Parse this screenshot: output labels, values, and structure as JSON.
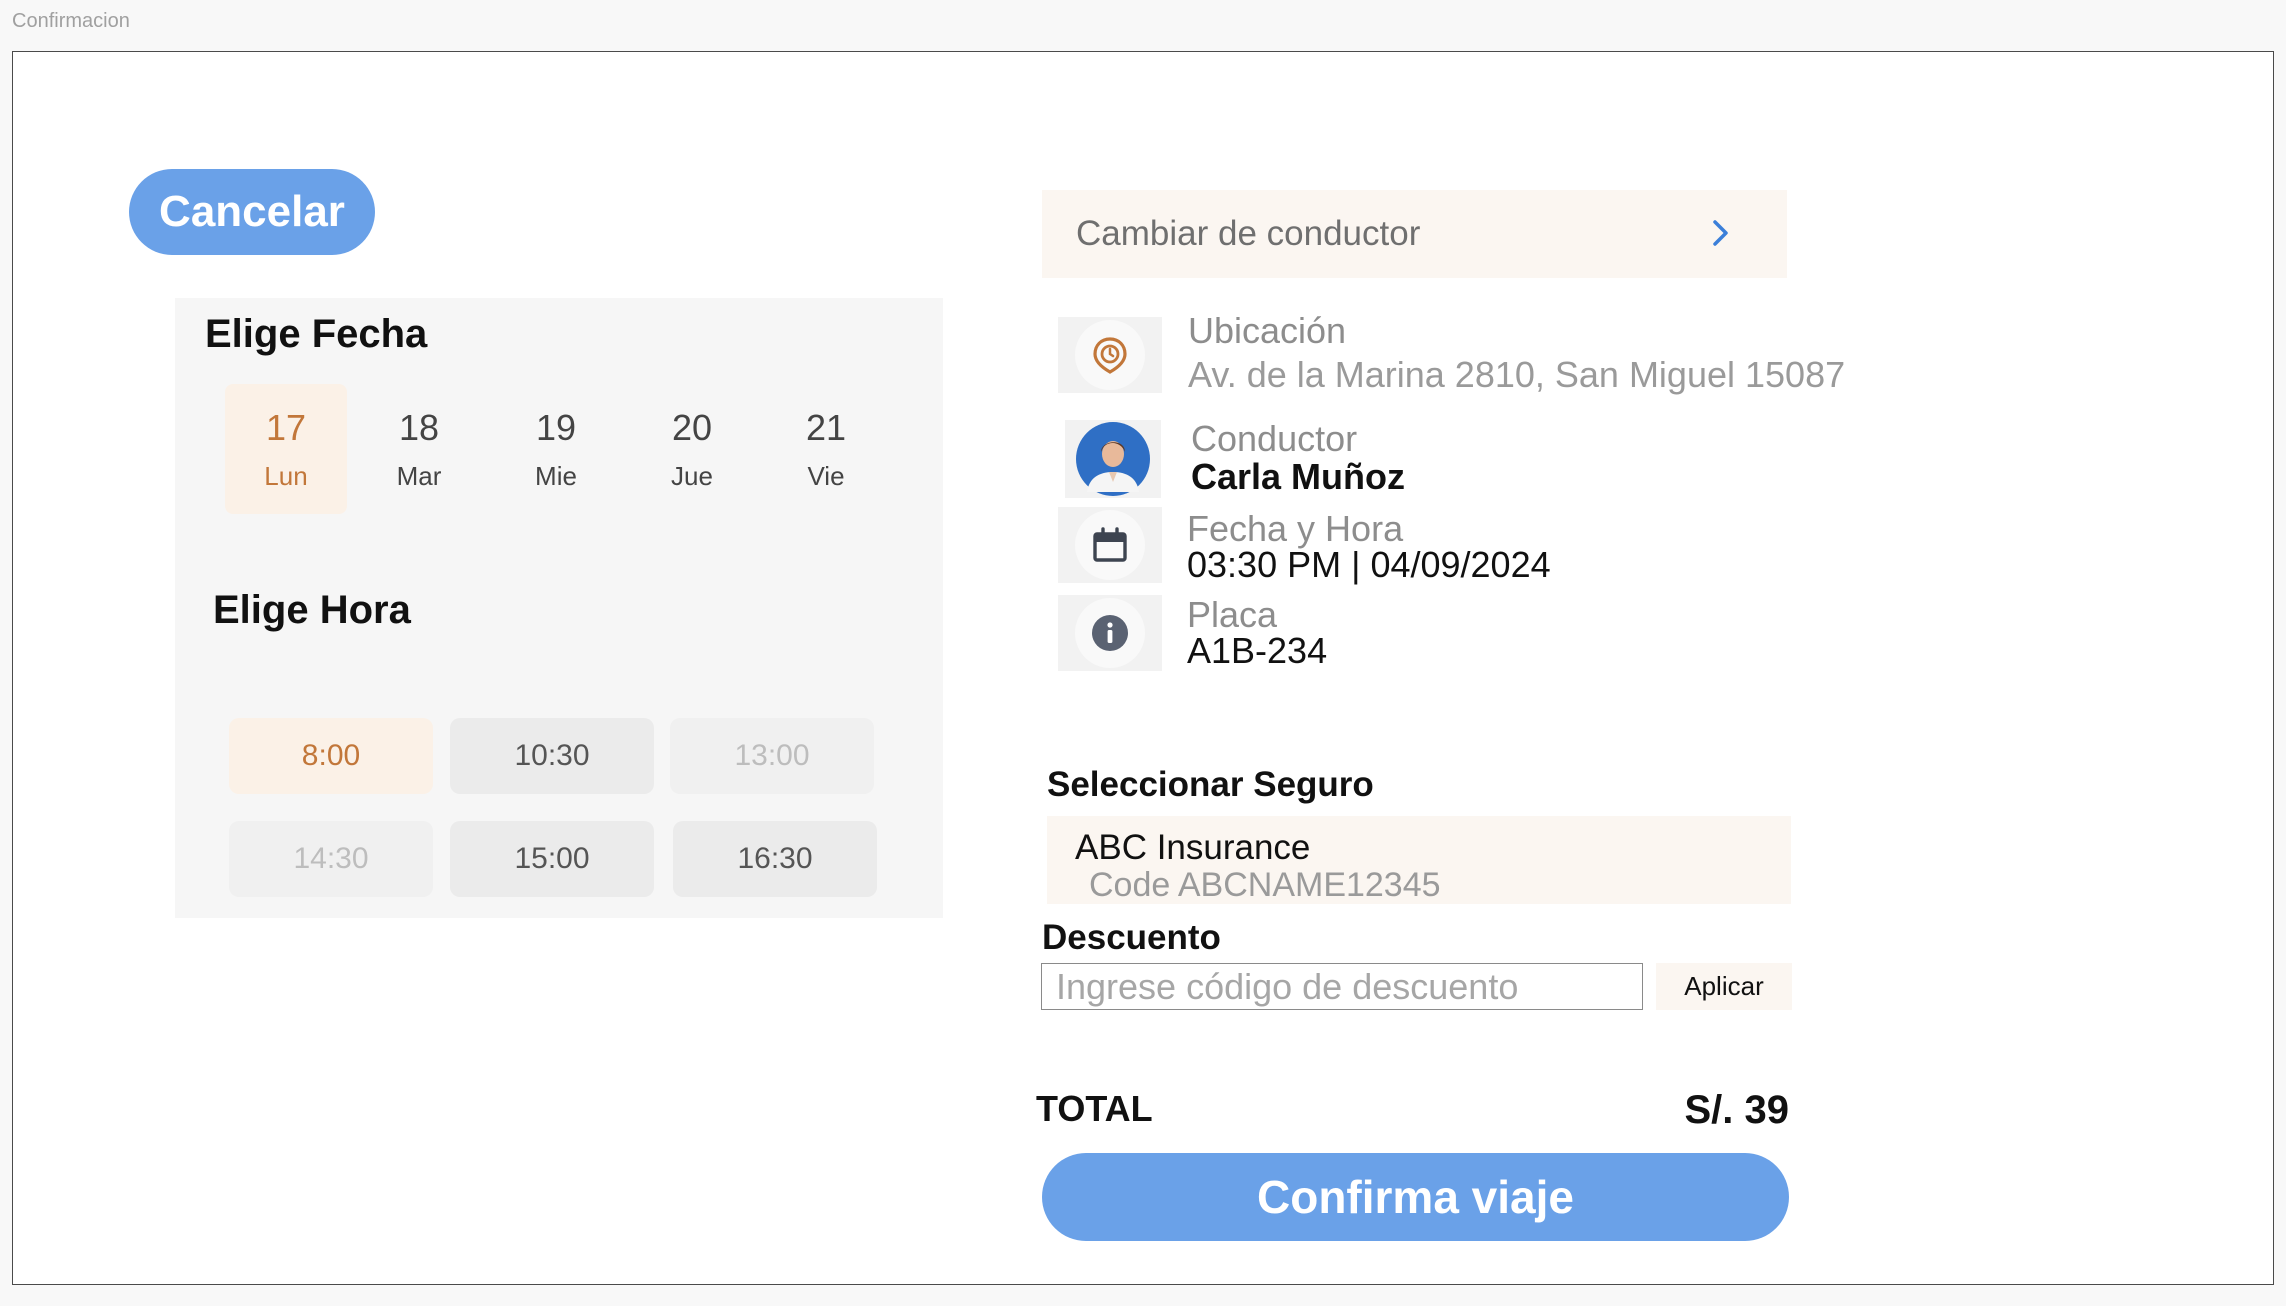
{
  "window": {
    "title": "Confirmacion"
  },
  "cancel_label": "Cancelar",
  "date_picker": {
    "title": "Elige Fecha",
    "days": [
      {
        "num": "17",
        "weekday": "Lun",
        "selected": true
      },
      {
        "num": "18",
        "weekday": "Mar",
        "selected": false
      },
      {
        "num": "19",
        "weekday": "Mie",
        "selected": false
      },
      {
        "num": "20",
        "weekday": "Jue",
        "selected": false
      },
      {
        "num": "21",
        "weekday": "Vie",
        "selected": false
      }
    ]
  },
  "time_picker": {
    "title": "Elige Hora",
    "slots": [
      {
        "time": "8:00",
        "state": "selected"
      },
      {
        "time": "10:30",
        "state": "available"
      },
      {
        "time": "13:00",
        "state": "disabled"
      },
      {
        "time": "14:30",
        "state": "disabled"
      },
      {
        "time": "15:00",
        "state": "available"
      },
      {
        "time": "16:30",
        "state": "available"
      }
    ]
  },
  "change_driver": {
    "label": "Cambiar de conductor",
    "icon": "chevron-right-icon"
  },
  "details": {
    "location": {
      "label": "Ubicación",
      "value": "Av. de la Marina 2810, San Miguel 15087",
      "icon": "location-clock-icon"
    },
    "driver": {
      "label": "Conductor",
      "value": "Carla Muñoz",
      "icon": "driver-avatar"
    },
    "datetime": {
      "label": "Fecha y Hora",
      "value": "03:30 PM | 04/09/2024",
      "icon": "calendar-icon"
    },
    "plate": {
      "label": "Placa",
      "value": "A1B-234",
      "icon": "info-icon"
    }
  },
  "insurance": {
    "title": "Seleccionar Seguro",
    "name": "ABC Insurance",
    "code": "Code ABCNAME12345"
  },
  "discount": {
    "title": "Descuento",
    "placeholder": "Ingrese código de descuento",
    "value": "",
    "apply_label": "Aplicar"
  },
  "total": {
    "label": "TOTAL",
    "amount": "S/. 39"
  },
  "confirm_label": "Confirma viaje",
  "colors": {
    "accent_blue": "#6aa1e8",
    "accent_orange": "#c2773a",
    "selected_bg": "#fbf1e7",
    "panel_bg": "#f6f6f6"
  }
}
